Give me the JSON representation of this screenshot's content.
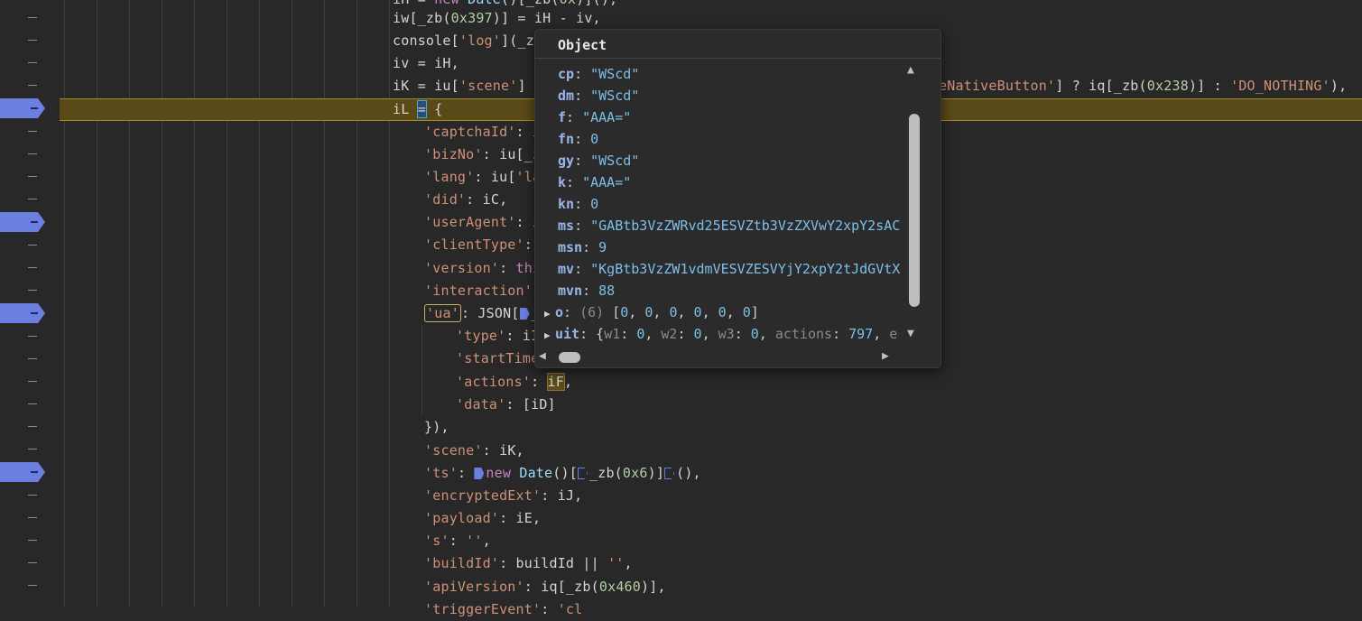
{
  "popover": {
    "title": "Object",
    "properties": [
      {
        "key": "cp",
        "value": "\"WScd\"",
        "kind": "string"
      },
      {
        "key": "dm",
        "value": "\"WScd\"",
        "kind": "string"
      },
      {
        "key": "f",
        "value": "\"AAA=\"",
        "kind": "string"
      },
      {
        "key": "fn",
        "value": "0",
        "kind": "number"
      },
      {
        "key": "gy",
        "value": "\"WScd\"",
        "kind": "string"
      },
      {
        "key": "k",
        "value": "\"AAA=\"",
        "kind": "string"
      },
      {
        "key": "kn",
        "value": "0",
        "kind": "number"
      },
      {
        "key": "ms",
        "value": "\"GABtb3VzZWRvd25ESVZtb3VzZXVwY2xpY2sAC",
        "kind": "string"
      },
      {
        "key": "msn",
        "value": "9",
        "kind": "number"
      },
      {
        "key": "mv",
        "value": "\"KgBtb3VzZW1vdmVESVZESVYjY2xpY2tJdGVtX",
        "kind": "string"
      },
      {
        "key": "mvn",
        "value": "88",
        "kind": "number"
      }
    ],
    "o_row": {
      "key": "o",
      "count": "(6)",
      "values": [
        "0",
        "0",
        "0",
        "0",
        "0",
        "0"
      ]
    },
    "uit_row": {
      "key": "uit",
      "w1": "0",
      "w2": "0",
      "w3": "0",
      "actions": "797",
      "tail": "e"
    }
  },
  "colors": {
    "background": "#282828",
    "breakpoint": "#6b7fe0",
    "current_line": "#5a4a18",
    "string": "#ce9178",
    "number": "#b5cea8"
  },
  "icons": [
    "breakpoint-marker-icon",
    "expand-triangle-icon",
    "scroll-up-arrow-icon",
    "scroll-down-arrow-icon",
    "scroll-left-arrow-icon",
    "scroll-right-arrow-icon"
  ]
}
